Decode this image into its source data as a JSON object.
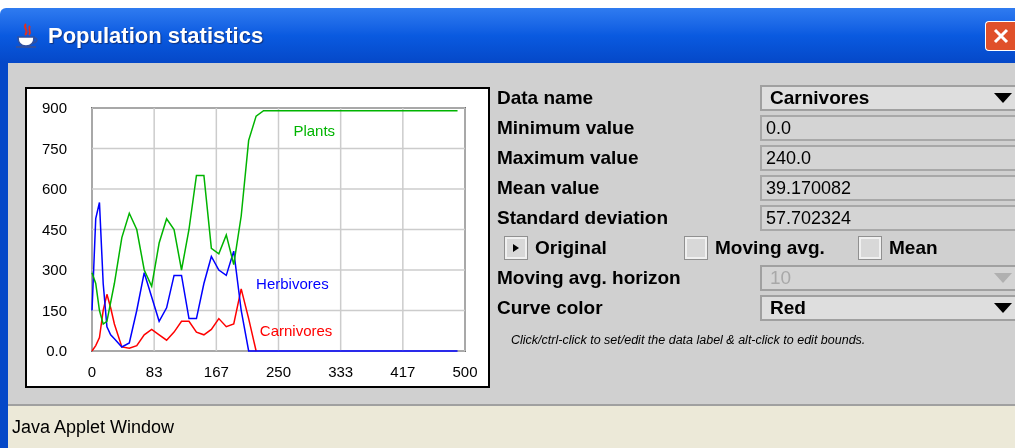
{
  "window": {
    "title": "Population statistics"
  },
  "chart": {
    "chart_data": {
      "type": "line",
      "x": [
        0,
        5,
        10,
        15,
        20,
        25,
        30,
        40,
        50,
        60,
        70,
        80,
        90,
        100,
        110,
        120,
        130,
        140,
        150,
        160,
        170,
        180,
        190,
        200,
        210,
        220,
        230,
        240,
        250,
        300,
        350,
        400,
        450,
        490
      ],
      "series": [
        {
          "name": "Plants",
          "color": "#00b400",
          "values": [
            290,
            250,
            150,
            100,
            110,
            180,
            250,
            420,
            510,
            450,
            300,
            240,
            400,
            490,
            450,
            300,
            450,
            650,
            650,
            380,
            360,
            430,
            320,
            500,
            780,
            870,
            890,
            890,
            890,
            890,
            890,
            890,
            890,
            890
          ]
        },
        {
          "name": "Herbivores",
          "color": "#0000ff",
          "values": [
            150,
            490,
            550,
            250,
            90,
            60,
            45,
            15,
            30,
            150,
            290,
            200,
            110,
            160,
            280,
            280,
            120,
            120,
            250,
            350,
            300,
            280,
            370,
            150,
            0,
            0,
            0,
            0,
            0,
            0,
            0,
            0,
            0,
            0
          ]
        },
        {
          "name": "Carnivores",
          "color": "#ff0000",
          "values": [
            0,
            20,
            50,
            150,
            210,
            160,
            100,
            15,
            10,
            20,
            60,
            80,
            60,
            40,
            70,
            110,
            110,
            70,
            60,
            80,
            120,
            90,
            100,
            230,
            120,
            0,
            null,
            null,
            null,
            null,
            null,
            null,
            null,
            null
          ]
        }
      ],
      "grid": true,
      "xlim": [
        0,
        500
      ],
      "ylim": [
        0,
        900
      ],
      "xticks": [
        {
          "value": 0,
          "label": "0"
        },
        {
          "value": 83.33,
          "label": "83"
        },
        {
          "value": 166.67,
          "label": "167"
        },
        {
          "value": 250,
          "label": "250"
        },
        {
          "value": 333.33,
          "label": "333"
        },
        {
          "value": 416.67,
          "label": "417"
        },
        {
          "value": 500,
          "label": "500"
        }
      ],
      "yticks": [
        {
          "value": 0,
          "label": "0.0"
        },
        {
          "value": 150,
          "label": "150"
        },
        {
          "value": 300,
          "label": "300"
        },
        {
          "value": 450,
          "label": "450"
        },
        {
          "value": 600,
          "label": "600"
        },
        {
          "value": 750,
          "label": "750"
        },
        {
          "value": 900,
          "label": "900"
        }
      ]
    }
  },
  "form": {
    "rows": [
      {
        "kind": "select",
        "label": "Data name",
        "value": "Carnivores",
        "disabled": false
      },
      {
        "kind": "field",
        "label": "Minimum value",
        "value": "0.0"
      },
      {
        "kind": "field",
        "label": "Maximum value",
        "value": "240.0"
      },
      {
        "kind": "field",
        "label": "Mean value",
        "value": "39.170082"
      },
      {
        "kind": "field",
        "label": "Standard deviation",
        "value": "57.702324"
      },
      {
        "kind": "checks",
        "options": [
          {
            "label": "Original",
            "checked": true
          },
          {
            "label": "Moving avg.",
            "checked": false
          },
          {
            "label": "Mean",
            "checked": false
          }
        ]
      },
      {
        "kind": "select",
        "label": "Moving avg. horizon",
        "value": "10",
        "disabled": true
      },
      {
        "kind": "select",
        "label": "Curve color",
        "value": "Red",
        "disabled": false
      }
    ],
    "hint": "Click/ctrl-click to set/edit the data label & alt-click to edit bounds."
  },
  "status_bar": "Java Applet Window"
}
